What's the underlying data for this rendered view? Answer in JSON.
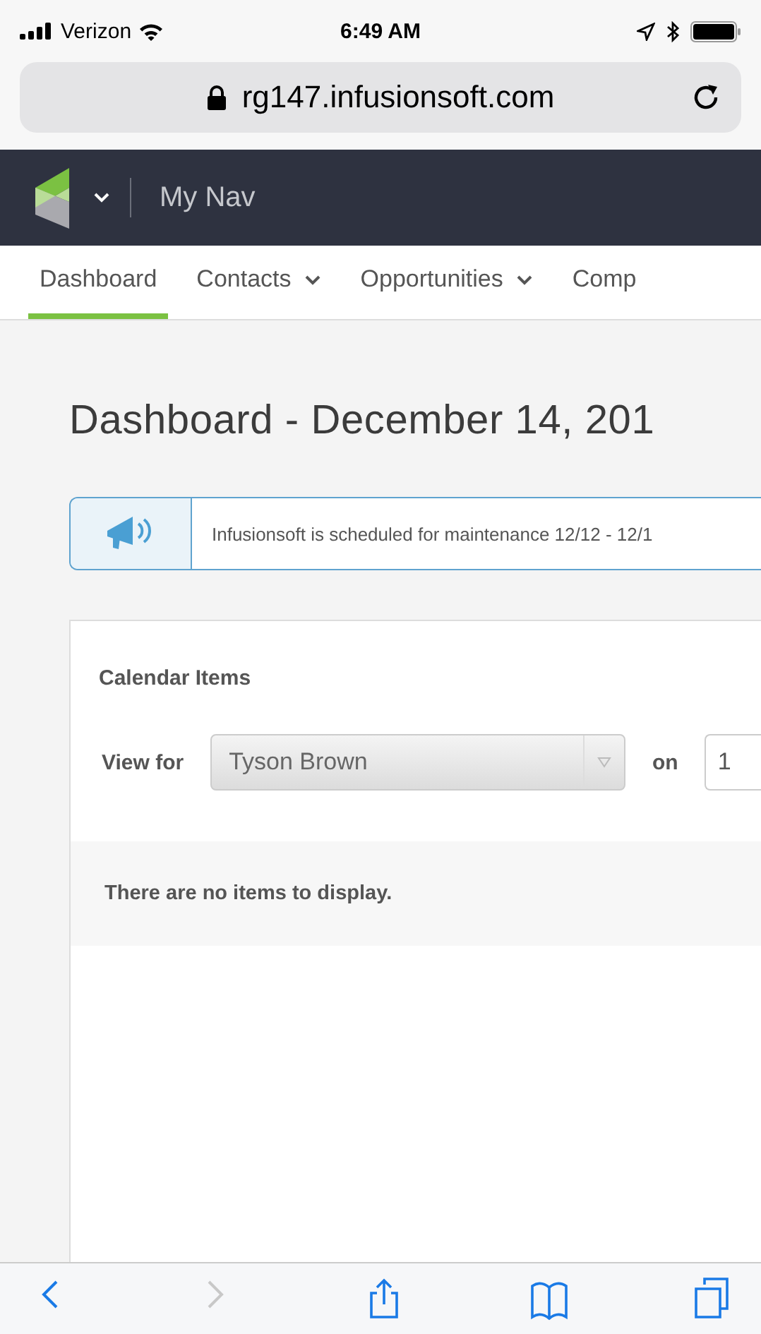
{
  "status_bar": {
    "carrier": "Verizon",
    "time": "6:49 AM"
  },
  "address_bar": {
    "url": "rg147.infusionsoft.com"
  },
  "app_header": {
    "title": "My Nav"
  },
  "tabs": [
    {
      "label": "Dashboard",
      "selected": true,
      "has_menu": false
    },
    {
      "label": "Contacts",
      "selected": false,
      "has_menu": true
    },
    {
      "label": "Opportunities",
      "selected": false,
      "has_menu": true
    },
    {
      "label": "Comp",
      "selected": false,
      "has_menu": false
    }
  ],
  "page_title": "Dashboard - December 14, 201",
  "notice": {
    "text": "Infusionsoft is scheduled for maintenance 12/12 - 12/1"
  },
  "calendar": {
    "title": "Calendar Items",
    "view_for_label": "View for",
    "user_select": "Tyson Brown",
    "on_label": "on",
    "date_value": "1",
    "empty_message": "There are no items to display."
  },
  "browser_toolbar": [
    {
      "kind": "back",
      "disabled": false
    },
    {
      "kind": "forward",
      "disabled": true
    },
    {
      "kind": "share",
      "disabled": false
    },
    {
      "kind": "bookmarks",
      "disabled": false
    },
    {
      "kind": "tabs",
      "disabled": false
    }
  ]
}
